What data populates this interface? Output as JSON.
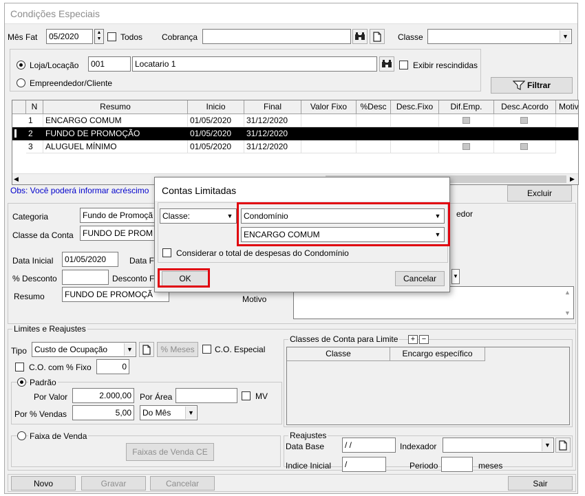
{
  "window": {
    "title": "Condições Especiais"
  },
  "top": {
    "mes_fat_label": "Mês Fat",
    "mes_fat_value": "05/2020",
    "todos_label": "Todos",
    "cobranca_label": "Cobrança",
    "cobranca_value": "",
    "classe_label": "Classe",
    "classe_value": "",
    "loja_label": "Loja/Locação",
    "loja_code": "001",
    "loja_name": "Locatario 1",
    "exibir_label": "Exibir rescindidas",
    "empreendedor_label": "Empreendedor/Cliente",
    "filtrar_label": "Filtrar"
  },
  "grid": {
    "columns": [
      "N",
      "Resumo",
      "Inicio",
      "Final",
      "Valor Fixo",
      "%Desc",
      "Desc.Fixo",
      "Dif.Emp.",
      "Desc.Acordo",
      "Motiv"
    ],
    "rows": [
      {
        "n": "1",
        "resumo": "ENCARGO COMUM",
        "inicio": "01/05/2020",
        "final": "31/12/2020"
      },
      {
        "n": "2",
        "resumo": "FUNDO DE PROMOÇÃO",
        "inicio": "01/05/2020",
        "final": "31/12/2020"
      },
      {
        "n": "3",
        "resumo": "ALUGUEL MÍNIMO",
        "inicio": "01/05/2020",
        "final": "31/12/2020"
      }
    ]
  },
  "obs": "Obs: Você poderá informar acréscimo",
  "excluir_label": "Excluir",
  "detail": {
    "categoria_label": "Categoria",
    "categoria_value": "Fundo de Promoçã",
    "classe_conta_label": "Classe da Conta",
    "classe_conta_value": "FUNDO DE PROM",
    "data_inicial_label": "Data Inicial",
    "data_inicial_value": "01/05/2020",
    "data_final_label": "Data Fi",
    "pct_desconto_label": "% Desconto",
    "pct_desconto_value": "",
    "desconto_fixo_label": "Desconto F",
    "resumo_label": "Resumo",
    "resumo_value": "FUNDO DE PROMOÇÃ",
    "motivo_label": "Motivo",
    "empreendedor_partial": "edor"
  },
  "limites": {
    "group_title": "Limites e Reajustes",
    "tipo_label": "Tipo",
    "tipo_value": "Custo de Ocupação",
    "meses_label": "% Meses",
    "co_especial_label": "C.O. Especial",
    "co_fixo_label": "C.O. com % Fixo",
    "co_fixo_value": "0",
    "padrao_label": "Padrão",
    "por_valor_label": "Por Valor",
    "por_valor_value": "2.000,00",
    "por_area_label": "Por Área",
    "por_area_value": "",
    "mv_label": "MV",
    "por_vendas_label": "Por % Vendas",
    "por_vendas_value": "5,00",
    "periodo_vendas_value": "Do Mês",
    "faixa_label": "Faixa de Venda",
    "faixas_button": "Faixas de Venda CE"
  },
  "classes_limite": {
    "title": "Classes de Conta para Limite",
    "columns": [
      "Classe",
      "Encargo específico"
    ]
  },
  "reajustes": {
    "title": "Reajustes",
    "data_base_label": "Data Base",
    "data_base_value": "/ /",
    "indexador_label": "Indexador",
    "indexador_value": "",
    "indice_inicial_label": "Indice Inicial",
    "indice_inicial_value": "/",
    "periodo_label": "Periodo",
    "periodo_value": "",
    "meses_label": "meses"
  },
  "bottom": {
    "novo": "Novo",
    "gravar": "Gravar",
    "cancelar": "Cancelar",
    "sair": "Sair"
  },
  "dialog": {
    "title": "Contas Limitadas",
    "classe_select": "Classe:",
    "classe_value": "Condomínio",
    "encargo_value": "ENCARGO COMUM",
    "considerar_label": "Considerar o total de despesas do Condomínio",
    "ok": "OK",
    "cancel": "Cancelar"
  },
  "colors": {
    "highlight": "#e0000d",
    "selection": "#000000",
    "obs_text": "#0000cc"
  }
}
